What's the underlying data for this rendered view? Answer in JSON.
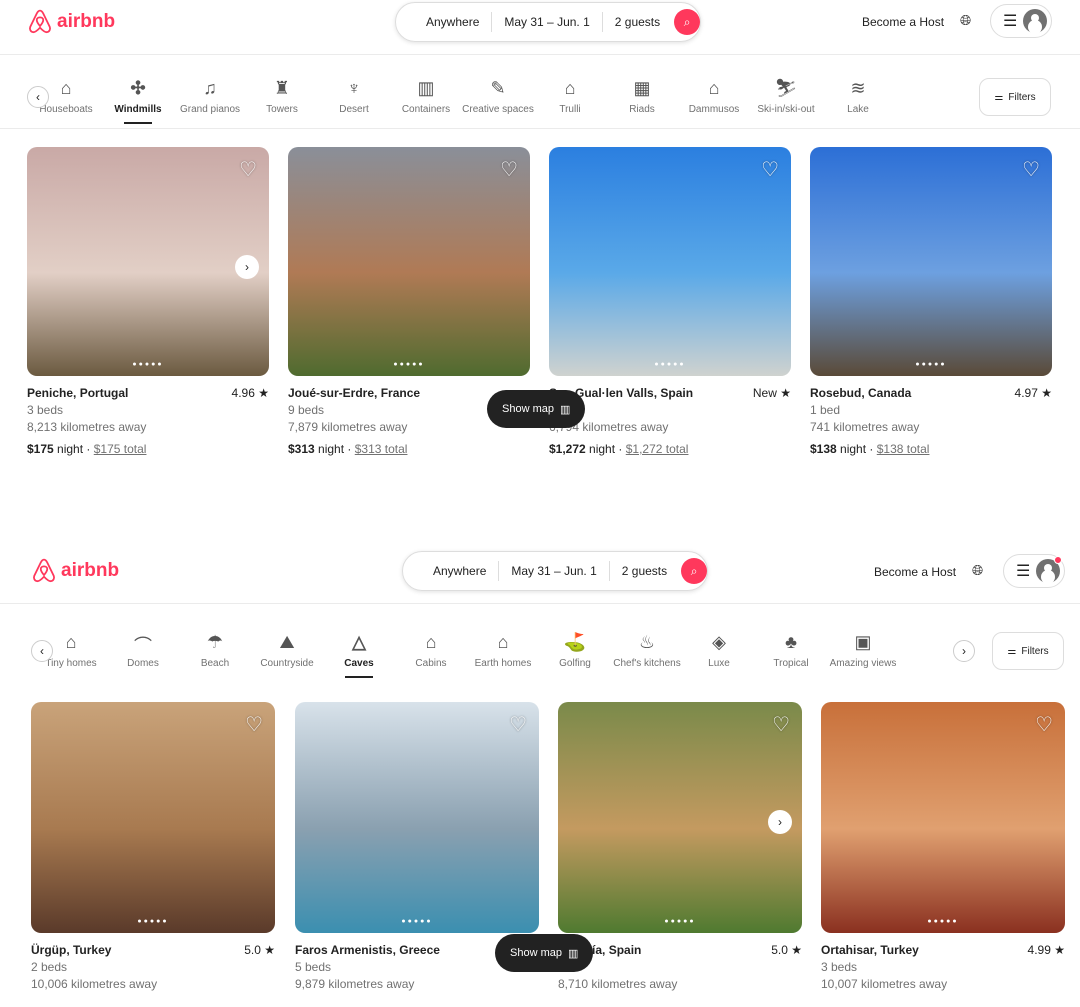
{
  "brand": "airbnb",
  "screens": [
    {
      "search": {
        "where": "Anywhere",
        "dates": "May 31 – Jun. 1",
        "guests": "2 guests"
      },
      "host_label": "Become a Host",
      "filters_label": "Filters",
      "show_map": "Show map",
      "notification": false,
      "categories": [
        {
          "label": "Houseboats",
          "icon": "⌂"
        },
        {
          "label": "Windmills",
          "icon": "✣",
          "active": true
        },
        {
          "label": "Grand pianos",
          "icon": "♫"
        },
        {
          "label": "Towers",
          "icon": "♜"
        },
        {
          "label": "Desert",
          "icon": "♆"
        },
        {
          "label": "Containers",
          "icon": "▥"
        },
        {
          "label": "Creative spaces",
          "icon": "✎"
        },
        {
          "label": "Trulli",
          "icon": "⌂"
        },
        {
          "label": "Riads",
          "icon": "▦"
        },
        {
          "label": "Dammusos",
          "icon": "⌂"
        },
        {
          "label": "Ski-in/ski-out",
          "icon": "⛷"
        },
        {
          "label": "Lake",
          "icon": "≋"
        }
      ],
      "listings": [
        {
          "title": "Peniche, Portugal",
          "rating": "4.96",
          "beds": "3 beds",
          "distance": "8,213 kilometres away",
          "price": "$175",
          "night": "night",
          "total": "$175 total",
          "colors": [
            "#c9a9a6",
            "#e2cfc6",
            "#6b5a40"
          ]
        },
        {
          "title": "Joué-sur-Erdre, France",
          "rating": "",
          "beds": "9 beds",
          "distance": "7,879 kilometres away",
          "price": "$313",
          "night": "night",
          "total": "$313 total",
          "colors": [
            "#8a8f99",
            "#b07a55",
            "#4f6b2f"
          ]
        },
        {
          "title": "Son Gual·len Valls, Spain",
          "rating": "New",
          "beds": "1 bed",
          "distance": "6,794 kilometres away",
          "price": "$1,272",
          "night": "night",
          "total": "$1,272 total",
          "colors": [
            "#2b7fe0",
            "#5aa9e8",
            "#cfd2cf"
          ]
        },
        {
          "title": "Rosebud, Canada",
          "rating": "4.97",
          "beds": "1 bed",
          "distance": "741 kilometres away",
          "price": "$138",
          "night": "night",
          "total": "$138 total",
          "colors": [
            "#2c6fd6",
            "#6da0e0",
            "#5a4a38"
          ]
        }
      ]
    },
    {
      "search": {
        "where": "Anywhere",
        "dates": "May 31 – Jun. 1",
        "guests": "2 guests"
      },
      "host_label": "Become a Host",
      "filters_label": "Filters",
      "show_map": "Show map",
      "notification": true,
      "categories": [
        {
          "label": "Tiny homes",
          "icon": "⌂"
        },
        {
          "label": "Domes",
          "icon": "⌒"
        },
        {
          "label": "Beach",
          "icon": "☂"
        },
        {
          "label": "Countryside",
          "icon": "⛰"
        },
        {
          "label": "Caves",
          "icon": "△",
          "active": true
        },
        {
          "label": "Cabins",
          "icon": "⌂"
        },
        {
          "label": "Earth homes",
          "icon": "⌂"
        },
        {
          "label": "Golfing",
          "icon": "⛳"
        },
        {
          "label": "Chef's kitchens",
          "icon": "♨"
        },
        {
          "label": "Luxe",
          "icon": "◈"
        },
        {
          "label": "Tropical",
          "icon": "♣"
        },
        {
          "label": "Amazing views",
          "icon": "▣"
        }
      ],
      "listings": [
        {
          "title": "Ürgüp, Turkey",
          "rating": "5.0",
          "beds": "2 beds",
          "distance": "10,006 kilometres away",
          "colors": [
            "#c9a37a",
            "#a87a50",
            "#5a3a2a"
          ]
        },
        {
          "title": "Faros Armenistis, Greece",
          "rating": "",
          "beds": "5 beds",
          "distance": "9,879 kilometres away",
          "colors": [
            "#d8e2ea",
            "#8aa0b0",
            "#3b8fb0"
          ]
        },
        {
          "title": "Almería, Spain",
          "rating": "5.0",
          "beds": "",
          "distance": "8,710 kilometres away",
          "colors": [
            "#7a8a4a",
            "#c49a60",
            "#4f7a30"
          ]
        },
        {
          "title": "Ortahisar, Turkey",
          "rating": "4.99",
          "beds": "3 beds",
          "distance": "10,007 kilometres away",
          "colors": [
            "#c8703a",
            "#e0a070",
            "#8a3020"
          ]
        }
      ]
    }
  ]
}
